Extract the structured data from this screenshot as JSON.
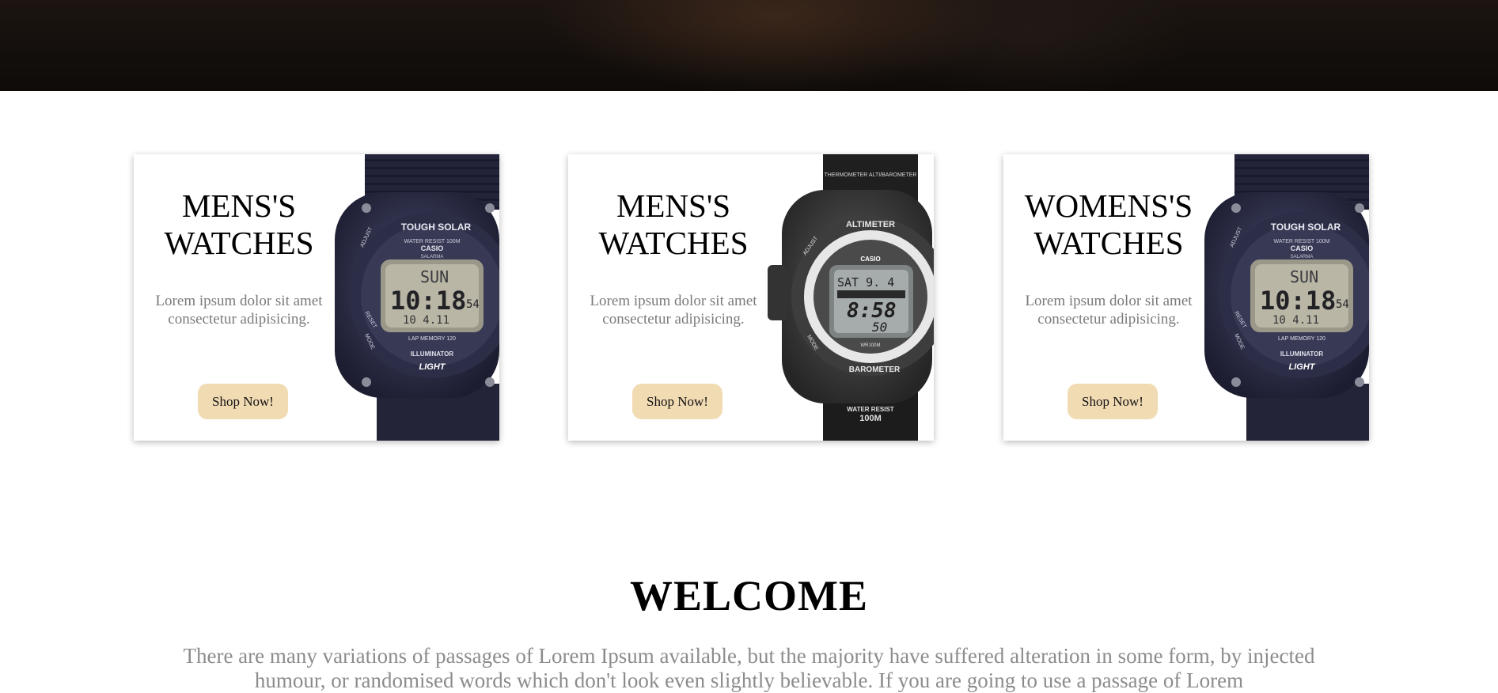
{
  "cards": [
    {
      "title_line1": "MENS'S",
      "title_line2": "WATCHES",
      "text_line1": "Lorem ipsum dolor sit amet",
      "text_line2": "consectetur adipisicing.",
      "button_label": "Shop Now!",
      "watch": {
        "brand": "CASIO",
        "label_top": "TOUGH SOLAR",
        "label_water": "WATER RESIST 100M",
        "sub_brand": "SALARMA",
        "day": "SUN",
        "time": "10:18",
        "seconds": "54",
        "date": "10 4.11",
        "label_lap": "LAP MEMORY 120",
        "label_illum": "ILLUMINATOR",
        "label_light": "LIGHT",
        "label_adjust": "ADJUST",
        "label_mode": "MODE",
        "label_reset": "RESET"
      }
    },
    {
      "title_line1": "MENS'S",
      "title_line2": "WATCHES",
      "text_line1": "Lorem ipsum dolor sit amet",
      "text_line2": "consectetur adipisicing.",
      "button_label": "Shop Now!",
      "watch": {
        "brand": "CASIO",
        "label_top": "THERMOMETER ALTI/BAROMETER",
        "label_altimeter": "ALTIMETER",
        "day": "SAT 9. 4",
        "time": "8:58",
        "seconds": "50",
        "label_barometer": "BAROMETER",
        "label_wr": "WR100M",
        "label_water": "WATER RESIST",
        "label_depth": "100M",
        "label_adjust": "ADJUST",
        "label_mode": "MODE"
      }
    },
    {
      "title_line1": "WOMENS'S",
      "title_line2": "WATCHES",
      "text_line1": "Lorem ipsum dolor sit amet",
      "text_line2": "consectetur adipisicing.",
      "button_label": "Shop Now!",
      "watch": {
        "brand": "CASIO",
        "label_top": "TOUGH SOLAR",
        "label_water": "WATER RESIST 100M",
        "sub_brand": "SALARMA",
        "day": "SUN",
        "time": "10:18",
        "seconds": "54",
        "date": "10 4.11",
        "label_lap": "LAP MEMORY 120",
        "label_illum": "ILLUMINATOR",
        "label_light": "LIGHT",
        "label_adjust": "ADJUST",
        "label_mode": "MODE",
        "label_reset": "RESET"
      }
    }
  ],
  "welcome": {
    "title": "WELCOME",
    "text": "There are many variations of passages of Lorem Ipsum available, but the majority have suffered alteration in some form, by injected humour, or randomised words which don't look even slightly believable. If you are going to use a passage of Lorem"
  },
  "colors": {
    "button_bg": "#f1dbb3",
    "hero_bg": "#120e0b",
    "muted_text": "#7a7a7a"
  }
}
